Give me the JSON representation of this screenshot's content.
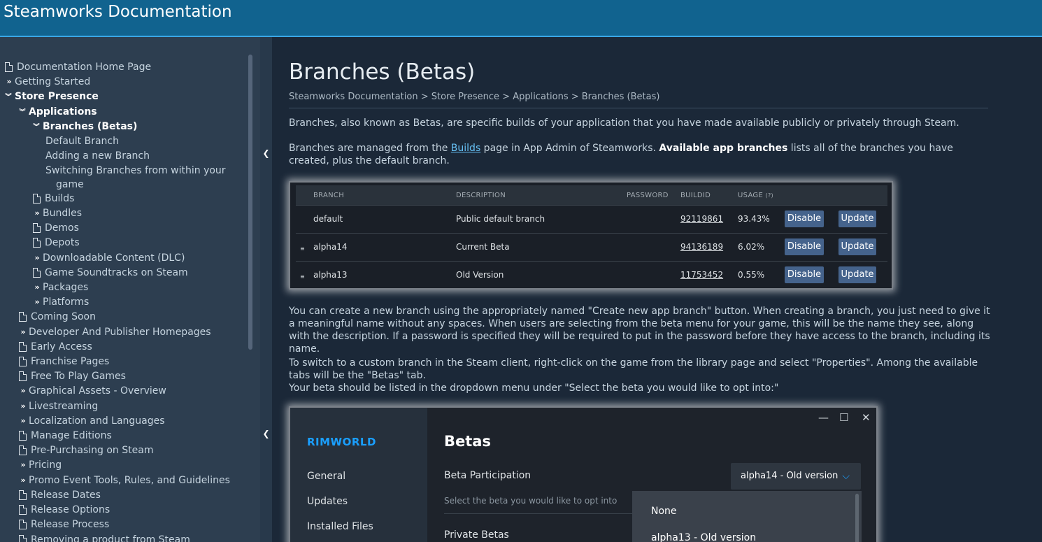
{
  "header": {
    "title": "Steamworks Documentation"
  },
  "sidebar": {
    "items": [
      {
        "label": "Documentation Home Page",
        "icon": "doc"
      },
      {
        "label": "Getting Started",
        "icon": "chevron-right"
      },
      {
        "label": "Store Presence",
        "icon": "chevron-down"
      },
      {
        "label": "Applications",
        "icon": "chevron-down"
      },
      {
        "label": "Branches (Betas)",
        "icon": "chevron-down"
      },
      {
        "label": "Default Branch",
        "icon": "none"
      },
      {
        "label": "Adding a new Branch",
        "icon": "none"
      },
      {
        "label": "Switching Branches from within your",
        "icon": "none"
      },
      {
        "label": "game",
        "icon": "none"
      },
      {
        "label": "Builds",
        "icon": "doc"
      },
      {
        "label": "Bundles",
        "icon": "chevron-right"
      },
      {
        "label": "Demos",
        "icon": "doc"
      },
      {
        "label": "Depots",
        "icon": "doc"
      },
      {
        "label": "Downloadable Content (DLC)",
        "icon": "chevron-right"
      },
      {
        "label": "Game Soundtracks on Steam",
        "icon": "doc"
      },
      {
        "label": "Packages",
        "icon": "chevron-right"
      },
      {
        "label": "Platforms",
        "icon": "chevron-right"
      },
      {
        "label": "Coming Soon",
        "icon": "doc"
      },
      {
        "label": "Developer And Publisher Homepages",
        "icon": "chevron-right"
      },
      {
        "label": "Early Access",
        "icon": "doc"
      },
      {
        "label": "Franchise Pages",
        "icon": "doc"
      },
      {
        "label": "Free To Play Games",
        "icon": "doc"
      },
      {
        "label": "Graphical Assets - Overview",
        "icon": "chevron-right"
      },
      {
        "label": "Livestreaming",
        "icon": "chevron-right"
      },
      {
        "label": "Localization and Languages",
        "icon": "chevron-right"
      },
      {
        "label": "Manage Editions",
        "icon": "doc"
      },
      {
        "label": "Pre-Purchasing on Steam",
        "icon": "doc"
      },
      {
        "label": "Pricing",
        "icon": "chevron-right"
      },
      {
        "label": "Promo Event Tools, Rules, and Guidelines",
        "icon": "chevron-right"
      },
      {
        "label": "Release Dates",
        "icon": "doc"
      },
      {
        "label": "Release Options",
        "icon": "doc"
      },
      {
        "label": "Release Process",
        "icon": "doc"
      },
      {
        "label": "Removing a product from Steam",
        "icon": "doc"
      }
    ]
  },
  "main": {
    "title": "Branches (Betas)",
    "breadcrumb": "Steamworks Documentation > Store Presence > Applications > Branches (Betas)",
    "p1": "Branches, also known as Betas, are specific builds of your application that you have made available publicly or privately through Steam.",
    "p2_before": "Branches are managed from the ",
    "p2_link": "Builds",
    "p2_mid": " page in App Admin of Steamworks. ",
    "p2_bold": "Available app branches",
    "p2_after": " lists all of the branches you have created, plus the default branch.",
    "p3": "You can create a new branch using the appropriately named \"Create new app branch\" button. When creating a branch, you just need to give it a meaningful name without any spaces. When users are selecting from the beta menu for your game, this will be the name they see, along with the description. If a password is specified they will be required to put in the password before they have access to the branch, including its name.",
    "p4": "To switch to a custom branch in the Steam client, right-click on the game from the library page and select \"Properties\". Among the available tabs will be the \"Betas\" tab.",
    "p5": "Your beta should be listed in the dropdown menu under \"Select the beta you would like to opt into:\""
  },
  "branches_table": {
    "headers": {
      "branch": "BRANCH",
      "description": "DESCRIPTION",
      "password": "PASSWORD",
      "buildid": "BUILDID",
      "usage": "USAGE",
      "usage_hint": "(?)"
    },
    "disable_label": "Disable",
    "update_label": "Update",
    "drag_glyph": "≡",
    "rows": [
      {
        "branch": "default",
        "description": "Public default branch",
        "buildid": "92119861",
        "usage": "93.43%"
      },
      {
        "branch": "alpha14",
        "description": "Current Beta",
        "buildid": "94136189",
        "usage": "6.02%"
      },
      {
        "branch": "alpha13",
        "description": "Old Version",
        "buildid": "11753452",
        "usage": "0.55%"
      }
    ]
  },
  "betas_dialog": {
    "game": "RIMWORLD",
    "tabs": [
      "General",
      "Updates",
      "Installed Files"
    ],
    "heading": "Betas",
    "participation_label": "Beta Participation",
    "selected": "alpha14 - Old version",
    "select_hint": "Select the beta you would like to opt into",
    "private_label": "Private Betas",
    "options": [
      "None",
      "alpha13 - Old version"
    ],
    "window_controls": {
      "minimize": "—",
      "maximize": "☐",
      "close": "✕"
    }
  }
}
